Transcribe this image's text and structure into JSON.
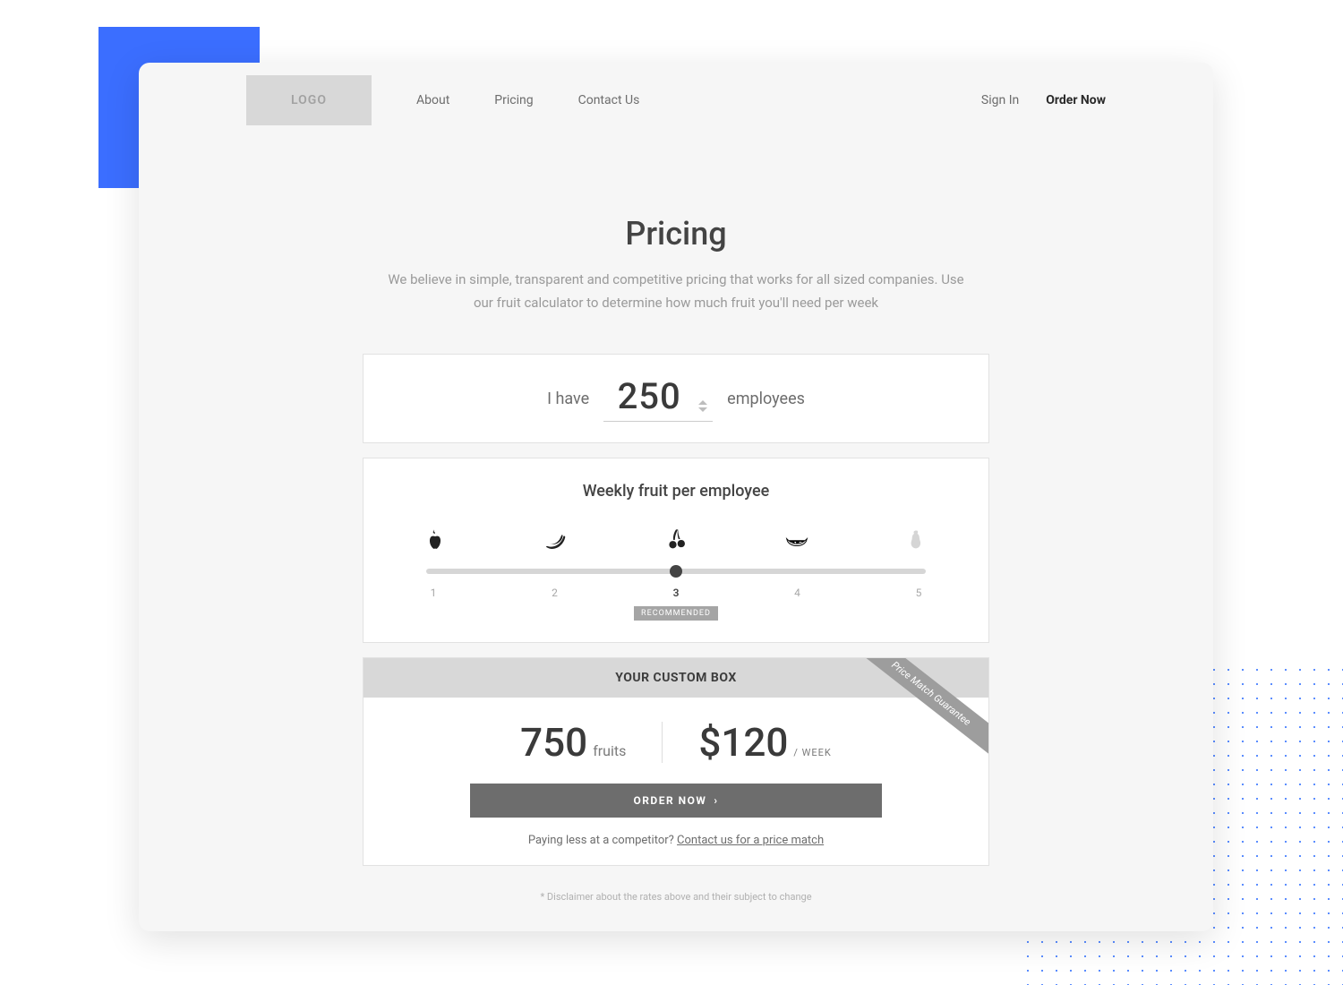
{
  "header": {
    "logo": "LOGO",
    "nav": {
      "about": "About",
      "pricing": "Pricing",
      "contact": "Contact Us"
    },
    "sign_in": "Sign In",
    "order_now": "Order Now"
  },
  "hero": {
    "title": "Pricing",
    "subtitle": "We believe in simple, transparent and competitive pricing that works for all sized companies. Use our fruit calculator to determine how much fruit you'll need per week"
  },
  "employees": {
    "prefix": "I have",
    "value": "250",
    "suffix": "employees"
  },
  "slider": {
    "title": "Weekly fruit per employee",
    "ticks": [
      "1",
      "2",
      "3",
      "4",
      "5"
    ],
    "selected_index": 2,
    "recommended_label": "RECOMMENDED",
    "icons": [
      "apple",
      "banana",
      "cherry",
      "citrus",
      "pear"
    ]
  },
  "result": {
    "header": "YOUR CUSTOM BOX",
    "ribbon": "Price Match Guarantee",
    "fruits_value": "750",
    "fruits_unit": "fruits",
    "price_value": "$120",
    "price_unit": "/ WEEK",
    "order_btn": "ORDER NOW",
    "match_prefix": "Paying less at a competitor? ",
    "match_link": "Contact us for a price match"
  },
  "disclaimer": "* Disclaimer about the rates above and their subject to change"
}
